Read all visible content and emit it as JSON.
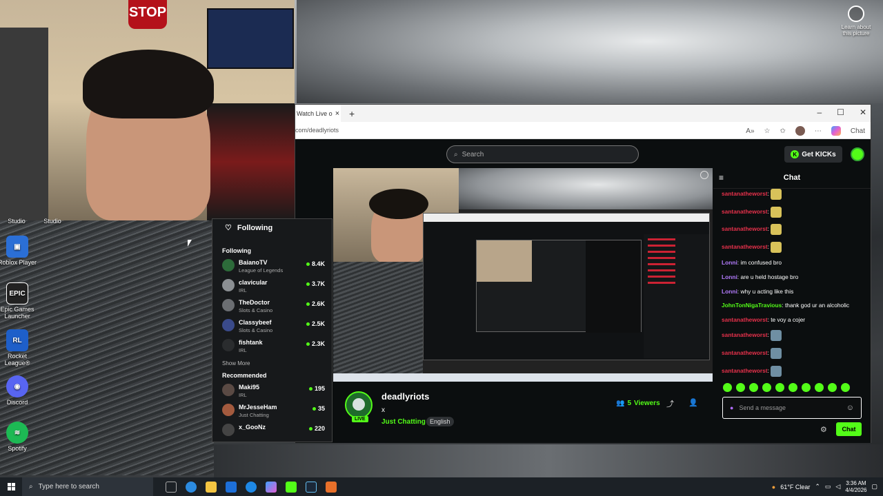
{
  "desktop": {
    "icons": [
      {
        "label": "Studio",
        "sub": "Studio"
      },
      {
        "label": "Roblox Player"
      },
      {
        "label": "Epic Games Launcher"
      },
      {
        "label": "Rocket League®"
      },
      {
        "label": "Discord"
      },
      {
        "label": "Spotify"
      }
    ],
    "learn_about": "Learn about this picture"
  },
  "browser": {
    "tab_title": "Watch Live o",
    "url": "com/deadlyriots",
    "copilot_label": "Chat"
  },
  "kick": {
    "search_placeholder": "Search",
    "get_kicks": "Get KICKs",
    "sidebar": {
      "header": "Following",
      "following_label": "Following",
      "following": [
        {
          "name": "BaianoTV",
          "category": "League of Legends",
          "viewers": "8.4K",
          "color": "#2d6b3a"
        },
        {
          "name": "clavicular",
          "category": "IRL",
          "viewers": "3.7K",
          "color": "#8b8f93"
        },
        {
          "name": "TheDoctor",
          "category": "Slots & Casino",
          "viewers": "2.6K",
          "color": "#6b6e72"
        },
        {
          "name": "Classybeef",
          "category": "Slots & Casino",
          "viewers": "2.5K",
          "color": "#3a4a8a"
        },
        {
          "name": "fishtank",
          "category": "IRL",
          "viewers": "2.3K",
          "color": "#2a2c2e"
        }
      ],
      "show_more": "Show More",
      "recommended_label": "Recommended",
      "recommended": [
        {
          "name": "Maki95",
          "category": "IRL",
          "viewers": "195",
          "color": "#5a4a44"
        },
        {
          "name": "MrJesseHam",
          "category": "Just Chatting",
          "viewers": "35",
          "color": "#a35a3e"
        },
        {
          "name": "x_GooNz",
          "category": "",
          "viewers": "220",
          "color": "#444"
        }
      ]
    },
    "stream": {
      "channel": "deadlyriots",
      "title": "x",
      "category": "Just Chatting",
      "language": "English",
      "live_badge": "LIVE",
      "viewers": "5",
      "viewers_label": "Viewers"
    },
    "chat": {
      "header": "Chat",
      "messages": [
        {
          "user": "santanatheworst",
          "text": "",
          "emote": "yellow",
          "color": "#e6314b"
        },
        {
          "user": "santanatheworst",
          "text": "",
          "emote": "yellow",
          "color": "#e6314b"
        },
        {
          "user": "santanatheworst",
          "text": "",
          "emote": "yellow",
          "color": "#e6314b"
        },
        {
          "user": "santanatheworst",
          "text": "",
          "emote": "yellow",
          "color": "#e6314b"
        },
        {
          "user": "Lonni",
          "text": "im confused bro",
          "emote": "",
          "color": "#b47cff"
        },
        {
          "user": "Lonni",
          "text": "are u held hostage bro",
          "emote": "",
          "color": "#b47cff"
        },
        {
          "user": "Lonni",
          "text": "why u acting like this",
          "emote": "",
          "color": "#b47cff"
        },
        {
          "user": "JohnTonNigaTravious",
          "text": "thank god ur an alcoholic",
          "emote": "",
          "color": "#53fc18"
        },
        {
          "user": "santanatheworst",
          "text": "te voy a cojer",
          "emote": "",
          "color": "#e6314b"
        },
        {
          "user": "santanatheworst",
          "text": "",
          "emote": "blue",
          "color": "#e6314b"
        },
        {
          "user": "santanatheworst",
          "text": "",
          "emote": "blue",
          "color": "#e6314b"
        },
        {
          "user": "santanatheworst",
          "text": "",
          "emote": "blue",
          "color": "#e6314b"
        }
      ],
      "input_placeholder": "Send a message",
      "send_label": "Chat"
    }
  },
  "taskbar": {
    "search_placeholder": "Type here to search",
    "weather": "61°F  Clear",
    "time": "3:36 AM",
    "date": "4/4/2026"
  },
  "colors": {
    "kick_green": "#53fc18",
    "chat_red": "#e6314b",
    "chat_purple": "#b47cff"
  }
}
